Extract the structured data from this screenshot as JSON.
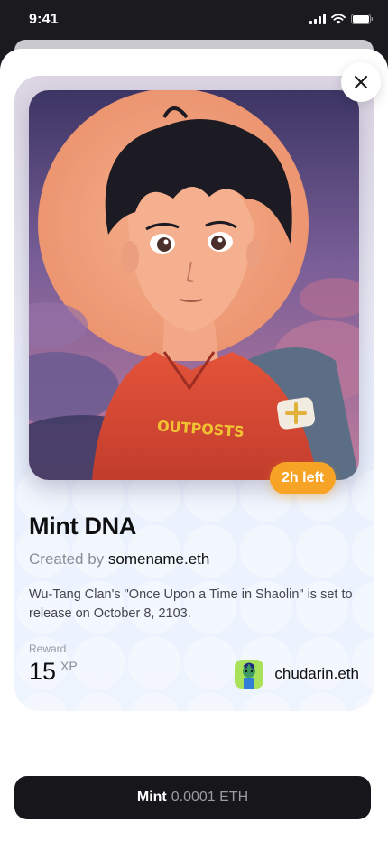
{
  "status_bar": {
    "time": "9:41"
  },
  "card": {
    "time_left": "2h left",
    "title": "Mint DNA",
    "created_by_label": "Created by",
    "creator": "somename.eth",
    "description": "Wu-Tang Clan's \"Once Upon a Time in Shaolin\" is set to release on October 8, 2103.",
    "reward": {
      "label": "Reward",
      "value": "15",
      "unit": "XP"
    },
    "owner": {
      "name": "chudarin.eth"
    },
    "artwork": {
      "jacket_text": "OUTPOSTS"
    }
  },
  "actions": {
    "mint_label": "Mint",
    "mint_price": "0.0001 ETH"
  },
  "colors": {
    "accent": "#f7a325",
    "button_bg": "#17171b",
    "card_bg": "#eaf1fd"
  },
  "icons": [
    "signal-icon",
    "wifi-icon",
    "battery-icon",
    "close-icon",
    "avatar-image"
  ]
}
